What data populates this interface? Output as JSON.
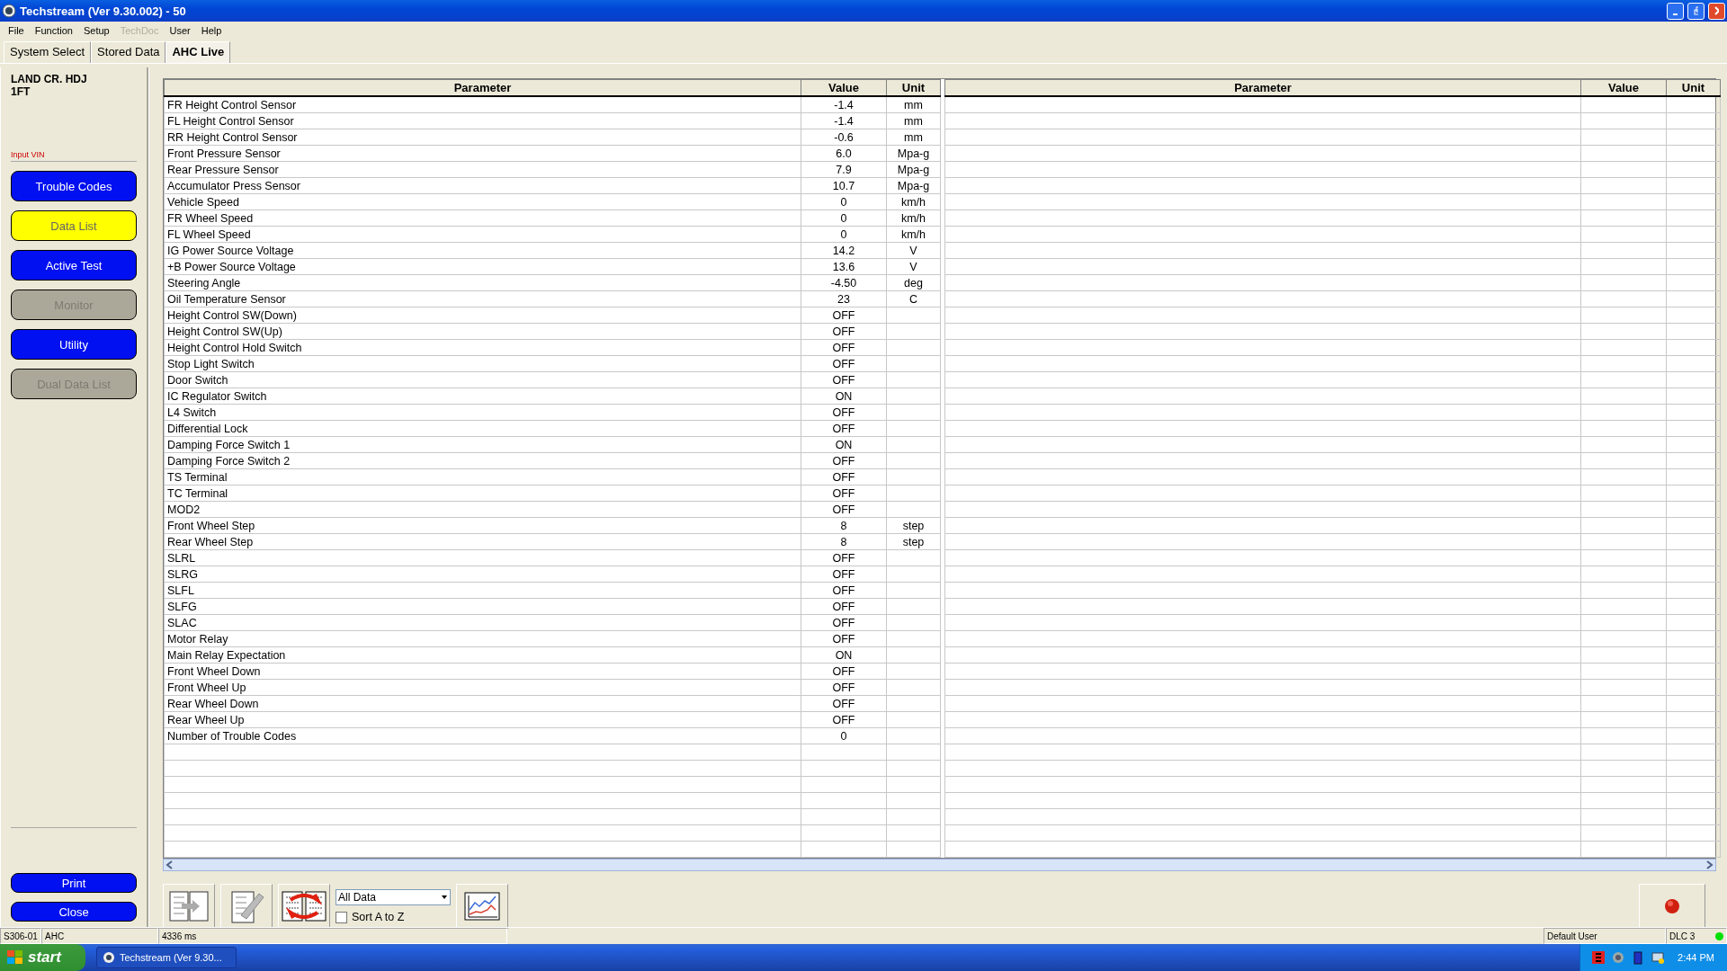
{
  "window": {
    "title": "Techstream (Ver 9.30.002) - 50"
  },
  "menu": [
    {
      "label": "File",
      "disabled": false
    },
    {
      "label": "Function",
      "disabled": false
    },
    {
      "label": "Setup",
      "disabled": false
    },
    {
      "label": "TechDoc",
      "disabled": true
    },
    {
      "label": "User",
      "disabled": false
    },
    {
      "label": "Help",
      "disabled": false
    }
  ],
  "tabs": [
    {
      "label": "System Select",
      "selected": false
    },
    {
      "label": "Stored Data",
      "selected": false
    },
    {
      "label": "AHC Live",
      "selected": true
    }
  ],
  "sidebar": {
    "vehicle_lines": [
      "LAND CR. HDJ",
      "1FT"
    ],
    "input_vin_link": "Input VIN",
    "buttons": [
      {
        "label": "Trouble Codes",
        "selected": false,
        "disabled": false
      },
      {
        "label": "Data List",
        "selected": true,
        "disabled": false
      },
      {
        "label": "Active Test",
        "selected": false,
        "disabled": false
      },
      {
        "label": "Monitor",
        "selected": false,
        "disabled": true
      },
      {
        "label": "Utility",
        "selected": false,
        "disabled": false
      },
      {
        "label": "Dual Data List",
        "selected": false,
        "disabled": true
      }
    ],
    "bottom_buttons": [
      "Print",
      "Close"
    ]
  },
  "tables": [
    {
      "columns": [
        "Parameter",
        "Value",
        "Unit"
      ],
      "rows": [
        {
          "parameter": "FR Height Control Sensor",
          "value": "-1.4",
          "unit": "mm"
        },
        {
          "parameter": "FL Height Control Sensor",
          "value": "-1.4",
          "unit": "mm"
        },
        {
          "parameter": "RR Height Control Sensor",
          "value": "-0.6",
          "unit": "mm"
        },
        {
          "parameter": "Front Pressure Sensor",
          "value": "6.0",
          "unit": "Mpa-g"
        },
        {
          "parameter": "Rear Pressure Sensor",
          "value": "7.9",
          "unit": "Mpa-g"
        },
        {
          "parameter": "Accumulator Press Sensor",
          "value": "10.7",
          "unit": "Mpa-g"
        },
        {
          "parameter": "Vehicle Speed",
          "value": "0",
          "unit": "km/h"
        },
        {
          "parameter": "FR Wheel Speed",
          "value": "0",
          "unit": "km/h"
        },
        {
          "parameter": "FL Wheel Speed",
          "value": "0",
          "unit": "km/h"
        },
        {
          "parameter": "IG Power Source Voltage",
          "value": "14.2",
          "unit": "V"
        },
        {
          "parameter": "+B Power Source Voltage",
          "value": "13.6",
          "unit": "V"
        },
        {
          "parameter": "Steering Angle",
          "value": "-4.50",
          "unit": "deg"
        },
        {
          "parameter": "Oil Temperature Sensor",
          "value": "23",
          "unit": "C"
        },
        {
          "parameter": "Height Control SW(Down)",
          "value": "OFF"
        },
        {
          "parameter": "Height Control SW(Up)",
          "value": "OFF"
        },
        {
          "parameter": "Height Control Hold Switch",
          "value": "OFF"
        },
        {
          "parameter": "Stop Light Switch",
          "value": "OFF"
        },
        {
          "parameter": "Door Switch",
          "value": "OFF"
        },
        {
          "parameter": "IC Regulator Switch",
          "value": "ON"
        },
        {
          "parameter": "L4 Switch",
          "value": "OFF"
        },
        {
          "parameter": "Differential Lock",
          "value": "OFF"
        },
        {
          "parameter": "Damping Force Switch 1",
          "value": "ON"
        },
        {
          "parameter": "Damping Force Switch 2",
          "value": "OFF"
        },
        {
          "parameter": "TS Terminal",
          "value": "OFF"
        },
        {
          "parameter": "TC Terminal",
          "value": "OFF"
        },
        {
          "parameter": "MOD2",
          "value": "OFF"
        },
        {
          "parameter": "Front Wheel Step",
          "value": "8",
          "unit": "step"
        },
        {
          "parameter": "Rear Wheel Step",
          "value": "8",
          "unit": "step"
        },
        {
          "parameter": "SLRL",
          "value": "OFF"
        },
        {
          "parameter": "SLRG",
          "value": "OFF"
        },
        {
          "parameter": "SLFL",
          "value": "OFF"
        },
        {
          "parameter": "SLFG",
          "value": "OFF"
        },
        {
          "parameter": "SLAC",
          "value": "OFF"
        },
        {
          "parameter": "Motor Relay",
          "value": "OFF"
        },
        {
          "parameter": "Main Relay Expectation",
          "value": "ON"
        },
        {
          "parameter": "Front Wheel Down",
          "value": "OFF"
        },
        {
          "parameter": "Front Wheel Up",
          "value": "OFF"
        },
        {
          "parameter": "Rear Wheel Down",
          "value": "OFF"
        },
        {
          "parameter": "Rear Wheel Up",
          "value": "OFF"
        },
        {
          "parameter": "Number of Trouble Codes",
          "value": "0"
        }
      ]
    },
    {
      "columns": [
        "Parameter",
        "Value",
        "Unit"
      ]
    }
  ],
  "toolbar": {
    "dropdown": {
      "value": "All Data"
    },
    "sort_checkbox": {
      "label": "Sort A to Z",
      "checked": false
    }
  },
  "status_bar": {
    "code": "S306-01",
    "system": "AHC",
    "interval": "4336 ms",
    "user": "Default User",
    "connection": "DLC 3",
    "connected": true
  },
  "taskbar": {
    "start": "start",
    "task": "Techstream (Ver 9.30...",
    "clock": "2:44 PM"
  }
}
